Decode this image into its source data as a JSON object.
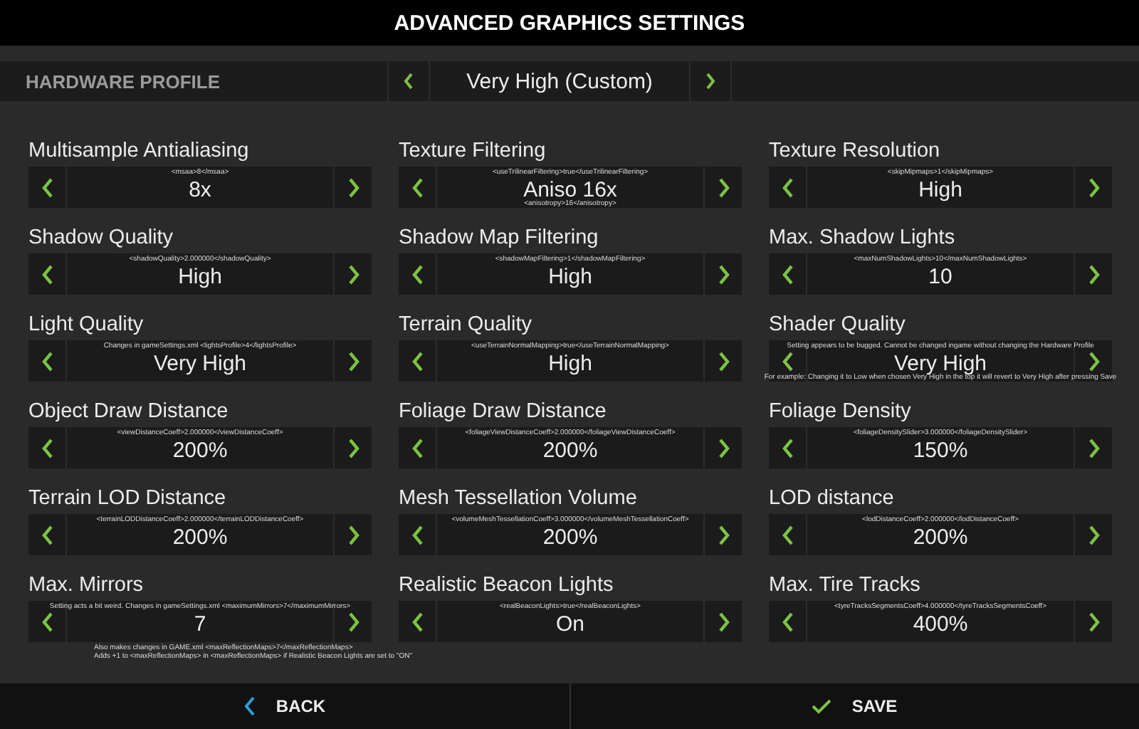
{
  "title": "ADVANCED GRAPHICS SETTINGS",
  "profile": {
    "label": "HARDWARE PROFILE",
    "value": "Very High (Custom)"
  },
  "settings": [
    {
      "label": "Multisample Antialiasing",
      "value": "8x",
      "note_top": "<msaa>8</msaa>"
    },
    {
      "label": "Texture Filtering",
      "value": "Aniso 16x",
      "note_top": "<useTrilinearFiltering>true</useTrilinearFiltering>",
      "note_bottom": "<anisotropy>16</anisotropy>"
    },
    {
      "label": "Texture Resolution",
      "value": "High",
      "note_top": "<skipMipmaps>1</skipMipmaps>"
    },
    {
      "label": "Shadow Quality",
      "value": "High",
      "note_top": "<shadowQuality>2.000000</shadowQuality>"
    },
    {
      "label": "Shadow Map Filtering",
      "value": "High",
      "note_top": "<shadowMapFiltering>1</shadowMapFiltering>"
    },
    {
      "label": "Max. Shadow Lights",
      "value": "10",
      "note_top": "<maxNumShadowLights>10</maxNumShadowLights>"
    },
    {
      "label": "Light Quality",
      "value": "Very High",
      "note_top": "Changes in gameSettings.xml <lightsProfile>4</lightsProfile>"
    },
    {
      "label": "Terrain Quality",
      "value": "High",
      "note_top": "<useTerrainNormalMapping>true</useTerrainNormalMapping>"
    },
    {
      "label": "Shader Quality",
      "value": "Very High",
      "note_top": "Setting appears to be bugged. Cannot be changed ingame without changing the Hardware Profile",
      "note_bottom": "For example: Changing it to Low when chosen Very High in the top it will revert to Very High after pressing Save"
    },
    {
      "label": "Object Draw Distance",
      "value": "200%",
      "note_top": "<viewDistanceCoeff>2.000000</viewDistanceCoeff>"
    },
    {
      "label": "Foliage Draw Distance",
      "value": "200%",
      "note_top": "<foliageViewDistanceCoeff>2.000000</foliageViewDistanceCoeff>"
    },
    {
      "label": "Foliage Density",
      "value": "150%",
      "note_top": "<foliageDensitySlider>3.000000</foliageDensitySlider>"
    },
    {
      "label": "Terrain LOD Distance",
      "value": "200%",
      "note_top": "<terrainLODDistanceCoeff>2.000000</terrainLODDistanceCoeff>"
    },
    {
      "label": "Mesh Tessellation Volume",
      "value": "200%",
      "note_top": "<volumeMeshTessellationCoeff>3.000000</volumeMeshTessellationCoeff>"
    },
    {
      "label": "LOD distance",
      "value": "200%",
      "note_top": "<lodDistanceCoeff>2.000000</lodDistanceCoeff>"
    },
    {
      "label": "Max. Mirrors",
      "value": "7",
      "note_top": "Setting acts a bit weird. Changes in gameSettings.xml <maximumMirrors>7</maximumMirrors>",
      "notes_below": [
        "Also makes changes in GAME.xml <maxReflectionMaps>7</maxReflectionMaps>",
        "Adds +1 to <maxReflectionMaps> in <maxReflectionMaps> if Realistic Beacon Lights are set to \"ON\""
      ]
    },
    {
      "label": "Realistic Beacon Lights",
      "value": "On",
      "note_top": "<realBeaconLights>true</realBeaconLights>"
    },
    {
      "label": "Max. Tire Tracks",
      "value": "400%",
      "note_top": "<tyreTracksSegmentsCoeff>4.000000</tyreTracksSegmentsCoeff>"
    }
  ],
  "footer": {
    "back": "BACK",
    "save": "SAVE"
  }
}
